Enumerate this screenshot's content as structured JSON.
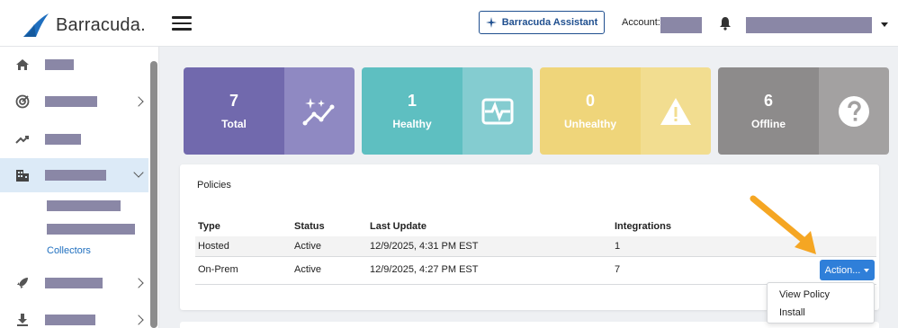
{
  "header": {
    "logo_text": "Barracuda.",
    "assistant_label": "Barracuda Assistant",
    "account_label": "Account:"
  },
  "sidebar": {
    "icons": [
      "home-icon",
      "radar-icon",
      "trend-icon",
      "building-icon",
      "rocket-icon",
      "download-icon"
    ],
    "collectors_label": "Collectors"
  },
  "stats": [
    {
      "count": "7",
      "label": "Total",
      "icon": "sparkle-line-icon",
      "left_color": "#7169ad",
      "right_color": "#8f89c2"
    },
    {
      "count": "1",
      "label": "Healthy",
      "icon": "heartbeat-icon",
      "left_color": "#5ebfc1",
      "right_color": "#84ccd0"
    },
    {
      "count": "0",
      "label": "Unhealthy",
      "icon": "warning-icon",
      "left_color": "#efd57a",
      "right_color": "#f2dd90"
    },
    {
      "count": "6",
      "label": "Offline",
      "icon": "question-icon",
      "left_color": "#8d8b8b",
      "right_color": "#a3a1a1"
    }
  ],
  "policies": {
    "title": "Policies",
    "columns": [
      "Type",
      "Status",
      "Last Update",
      "Integrations"
    ],
    "rows": [
      {
        "type": "Hosted",
        "status": "Active",
        "last_update": "12/9/2025, 4:31 PM EST",
        "integrations": "1"
      },
      {
        "type": "On-Prem",
        "status": "Active",
        "last_update": "12/9/2025, 4:27 PM EST",
        "integrations": "7"
      }
    ],
    "action_label": "Action...",
    "menu": [
      "View Policy",
      "Install"
    ]
  },
  "colors": {
    "accent": "#2f7fd9",
    "nav_active": "#dceaf7",
    "arrow": "#f5a623"
  }
}
